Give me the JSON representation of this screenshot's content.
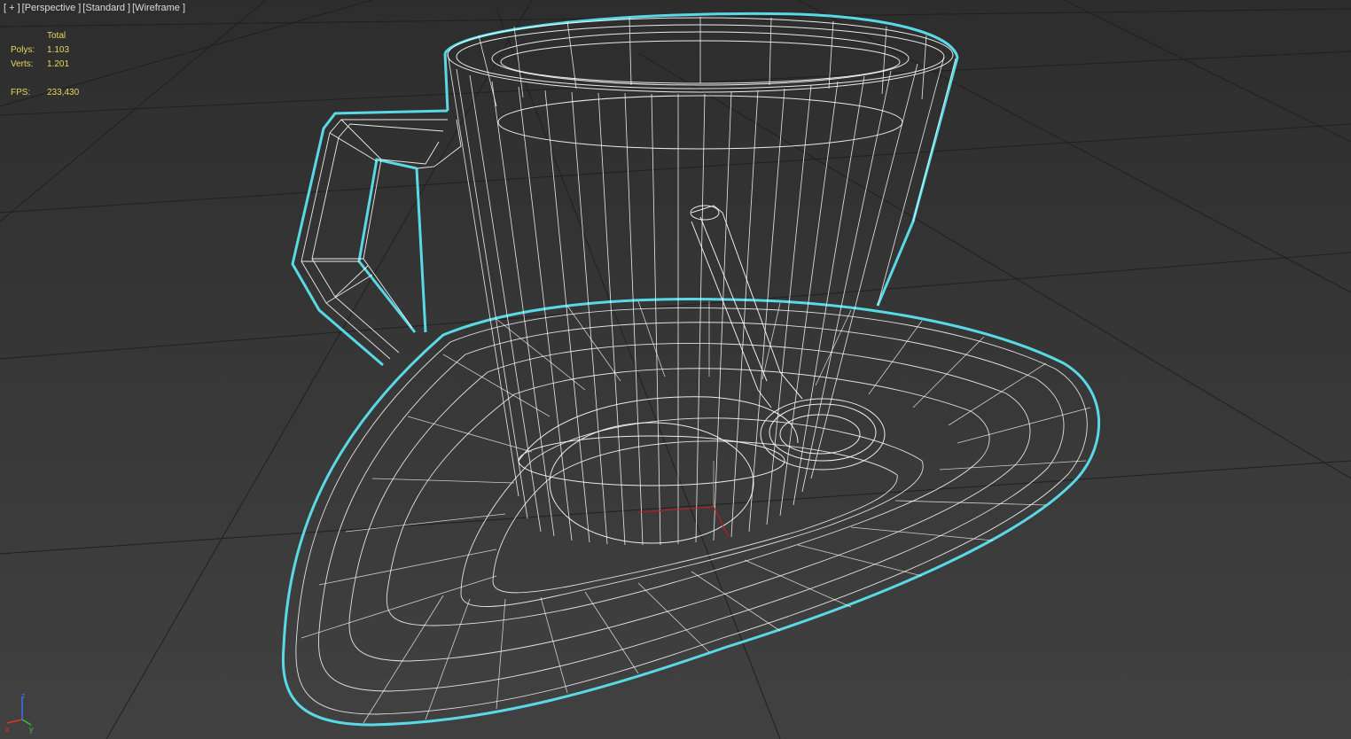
{
  "viewport": {
    "labels": [
      "[ + ]",
      "[Perspective ]",
      "[Standard ]",
      "[Wireframe ]"
    ]
  },
  "stats": {
    "header": "Total",
    "polys_label": "Polys:",
    "polys_value": "1.103",
    "verts_label": "Verts:",
    "verts_value": "1.201",
    "fps_label": "FPS:",
    "fps_value": "233,430"
  },
  "colors": {
    "background": "#3a3a3a",
    "grid": "#222222",
    "wire": "#ffffff",
    "selection_outline": "#59d9e6",
    "stats_text": "#e8d85a",
    "pivot_x": "#d11a1a"
  },
  "scene": {
    "objects": [
      "cup",
      "saucer",
      "spoon"
    ],
    "gizmo_icon": "axis-tripod-icon"
  }
}
